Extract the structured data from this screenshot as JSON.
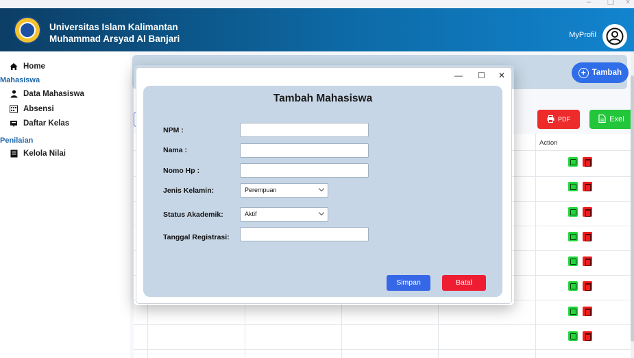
{
  "window": {
    "minimize_glyph": "–",
    "restore_glyph": "❐",
    "close_glyph": "×"
  },
  "header": {
    "title_line1": "Universitas Islam Kalimantan",
    "title_line2": "Muhammad Arsyad Al Banjari",
    "profile_label": "MyProfil",
    "profile_icon": "user-circle-icon",
    "gradient_colors": [
      "#0c3e66",
      "#1284cf"
    ]
  },
  "sidebar": {
    "home": "Home",
    "section_mahasiswa": "Mahasiswa",
    "items_mahasiswa": [
      "Data Mahasiswa",
      "Absensi",
      "Daftar Kelas"
    ],
    "section_penilaian": "Penilaian",
    "items_penilaian": [
      "Kelola Nilai"
    ],
    "section_color": "#1e66a8"
  },
  "main": {
    "tambah_label": "Tambah",
    "pdf_label": "PDF",
    "exel_label": "Exel",
    "action_header": "Action",
    "row_count": 8
  },
  "modal": {
    "minimize": "—",
    "maximize": "☐",
    "close": "✕",
    "title": "Tambah Mahasiswa",
    "fields": {
      "npm_label": "NPM :",
      "npm_value": "",
      "nama_label": "Nama :",
      "nama_value": "",
      "hp_label": "Nomo Hp :",
      "hp_value": "",
      "jk_label": "Jenis Kelamin:",
      "jk_value": "Perempuan",
      "status_label": "Status Akademik:",
      "status_value": "Aktif",
      "tgl_label": "Tanggal Registrasi:",
      "tgl_value": ""
    },
    "simpan_label": "Simpan",
    "batal_label": "Batal",
    "simpan_color": "#3667e6",
    "batal_color": "#ee1d32"
  }
}
